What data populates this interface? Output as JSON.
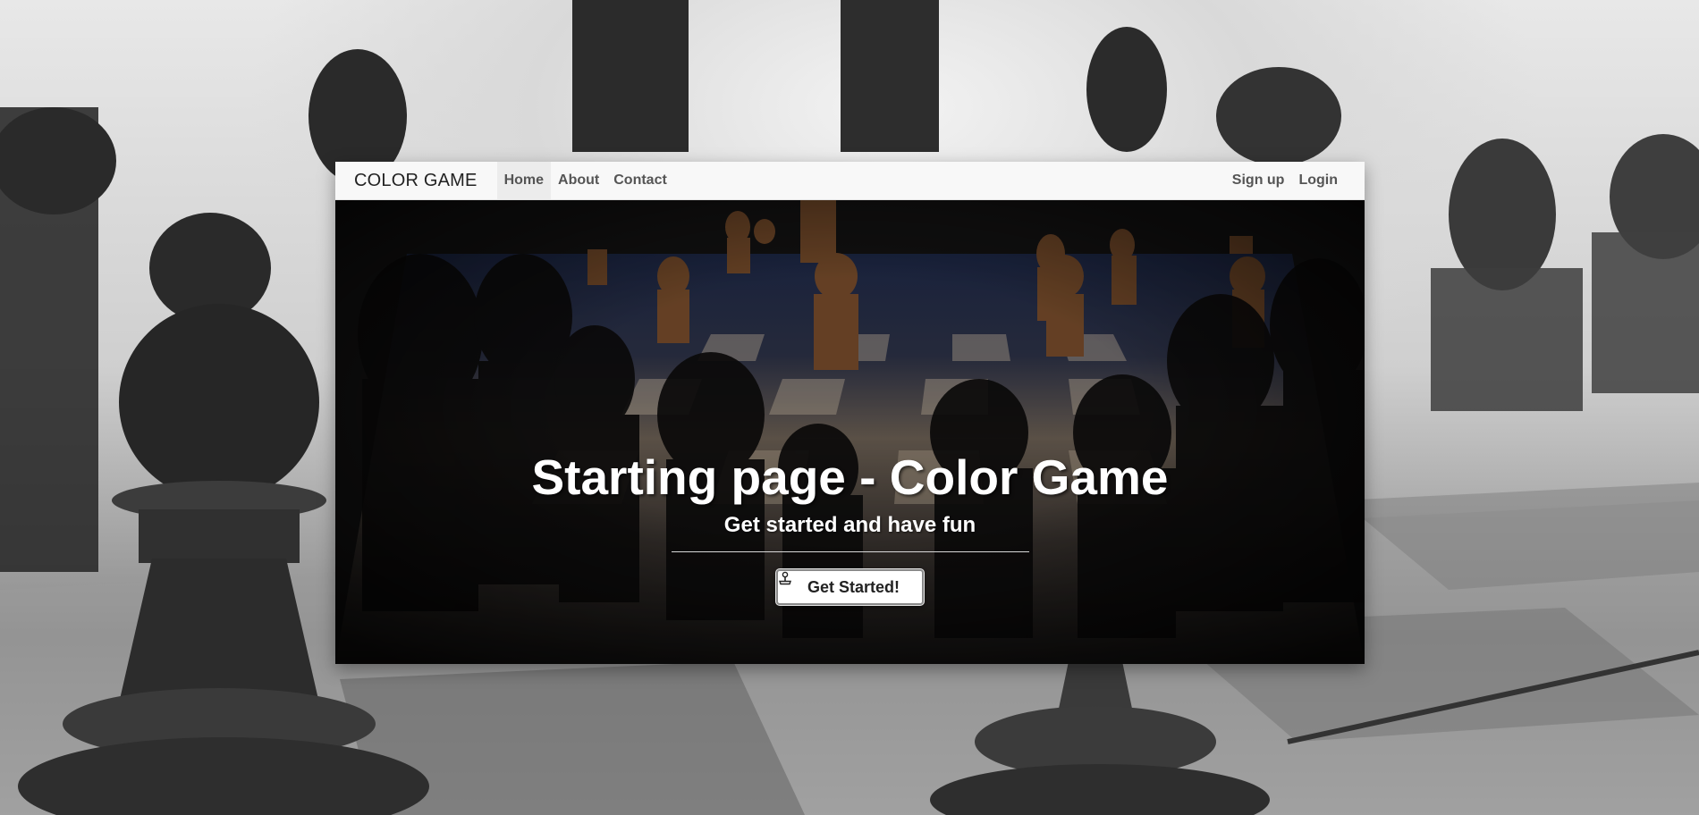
{
  "navbar": {
    "brand": "COLOR GAME",
    "left_links": [
      {
        "label": "Home",
        "active": true
      },
      {
        "label": "About",
        "active": false
      },
      {
        "label": "Contact",
        "active": false
      }
    ],
    "right_links": [
      {
        "label": "Sign up"
      },
      {
        "label": "Login"
      }
    ]
  },
  "hero": {
    "title": "Starting page - Color Game",
    "subtitle": "Get started and have fun",
    "button_label": "Get Started!",
    "button_icon": "joystick-icon"
  },
  "colors": {
    "navbar_bg": "#f8f8f8",
    "hero_bg": "#141313",
    "hero_text": "#ffffff",
    "button_bg": "#ffffff"
  }
}
